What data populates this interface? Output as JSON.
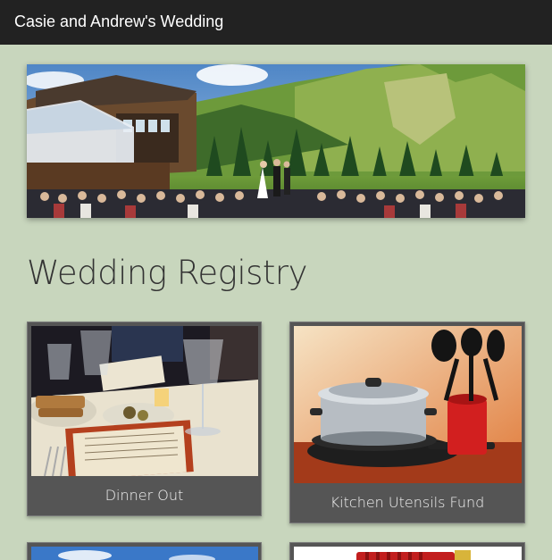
{
  "navbar": {
    "brand": "Casie and Andrew's Wedding"
  },
  "page": {
    "heading": "Wedding Registry"
  },
  "registry": {
    "items": [
      {
        "caption": "Dinner Out",
        "image": "dinner-table-photo"
      },
      {
        "caption": "Kitchen Utensils Fund",
        "image": "kitchen-pots-photo"
      },
      {
        "caption": "",
        "image": "sky-landscape-photo"
      },
      {
        "caption": "",
        "image": "red-tool-photo"
      }
    ]
  },
  "colors": {
    "background": "#c8d6bd",
    "navbar": "#222222",
    "card": "#555555",
    "heading": "#333333"
  }
}
